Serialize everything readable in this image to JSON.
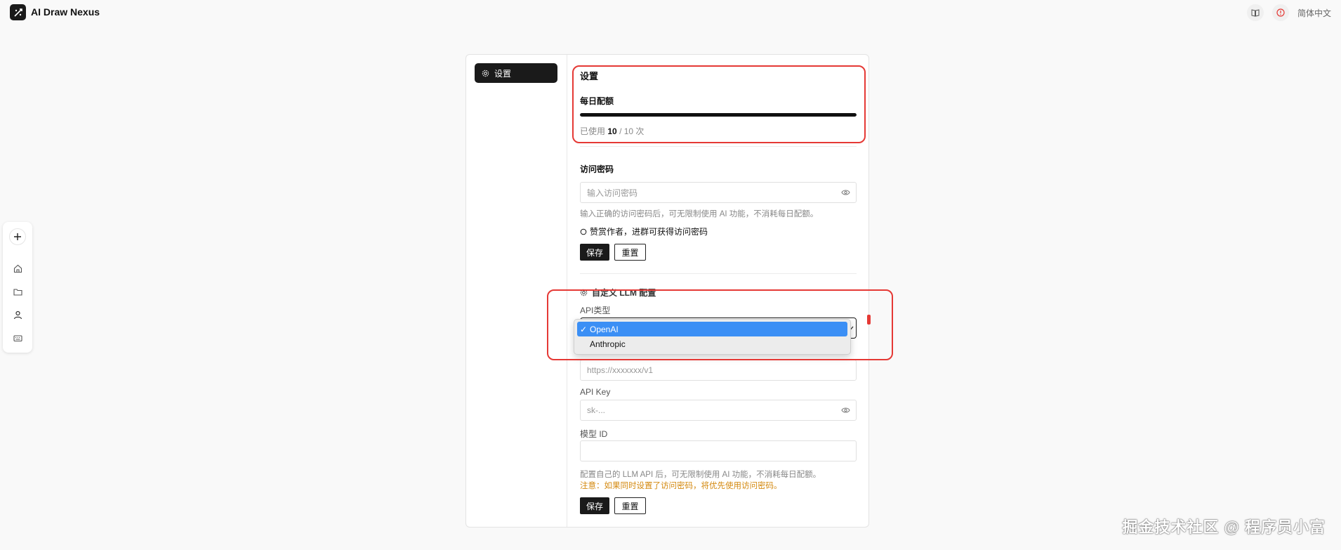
{
  "app": {
    "title": "AI Draw Nexus"
  },
  "topbar": {
    "language": "简体中文",
    "icons": [
      "book-icon",
      "info-icon"
    ]
  },
  "side_tools": [
    "plus-icon",
    "home-icon",
    "folder-icon",
    "user-icon",
    "keyboard-icon"
  ],
  "settings_nav": {
    "label": "设置"
  },
  "settings": {
    "title": "设置",
    "quota_label": "每日配额",
    "quota_progress": 1.0,
    "usage_prefix": "已使用",
    "used": "10",
    "usage_total": "/ 10 次"
  },
  "access": {
    "label": "访问密码",
    "placeholder": "输入访问密码",
    "hint": "输入正确的访问密码后，可无限制使用 AI 功能，不消耗每日配额。",
    "sponsor_text": "赞赏作者，进群可获得访问密码",
    "save_label": "保存",
    "reset_label": "重置"
  },
  "llm": {
    "title": "自定义 LLM 配置",
    "api_type_label": "API类型",
    "api_type_options": [
      "OpenAI",
      "Anthropic"
    ],
    "api_type_selected": "OpenAI",
    "base_url_placeholder": "https://xxxxxxx/v1",
    "api_key_label": "API Key",
    "api_key_placeholder": "sk-...",
    "model_label": "模型 ID",
    "hint": "配置自己的 LLM API 后，可无限制使用 AI 功能，不消耗每日配额。",
    "warning": "注意：如果同时设置了访问密码，将优先使用访问密码。",
    "save_label": "保存",
    "reset_label": "重置"
  },
  "watermark": "掘金技术社区 @ 程序员小富",
  "colors": {
    "annotation_red": "#e53935",
    "select_blue": "#3b8ff5",
    "warning": "#d4890f"
  }
}
